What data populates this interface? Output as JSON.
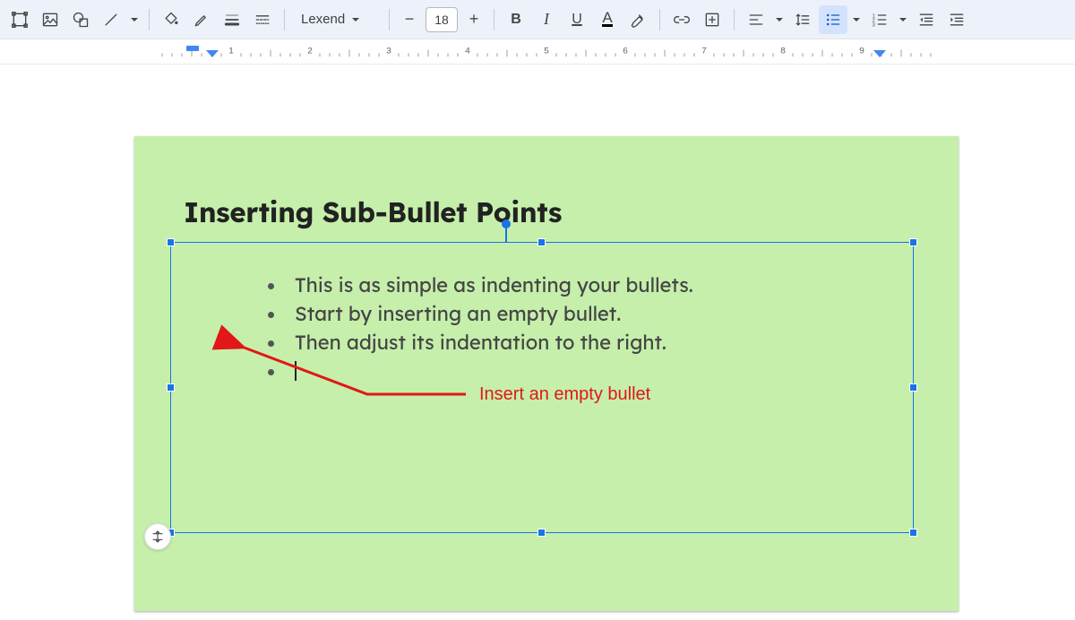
{
  "toolbar": {
    "font_family": "Lexend",
    "font_size": "18",
    "decrease": "−",
    "increase": "+"
  },
  "ruler": {
    "labels": [
      "1",
      "2",
      "3",
      "4",
      "5",
      "6",
      "7",
      "8",
      "9"
    ]
  },
  "slide": {
    "title": "Inserting Sub-Bullet Points",
    "bullets": [
      "This is as simple as indenting your bullets.",
      "Start by inserting an empty bullet.",
      "Then adjust its indentation to the right.",
      ""
    ],
    "annotation": "Insert an empty bullet"
  }
}
